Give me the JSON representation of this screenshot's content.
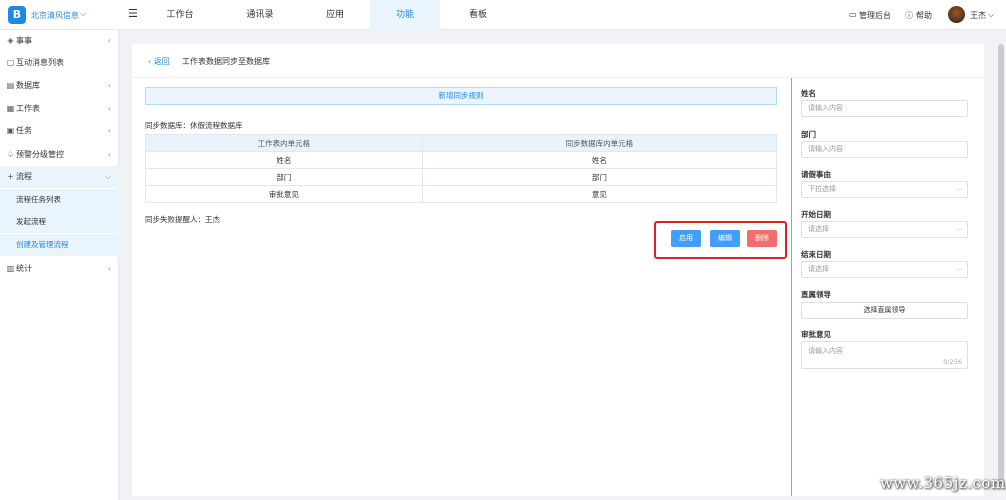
{
  "topbar": {
    "logo_char": "B",
    "org_name": "北京清风信息",
    "menu_toggle": "☰",
    "nav": [
      "工作台",
      "通讯录",
      "应用",
      "功能",
      "看板"
    ],
    "admin": "管理后台",
    "help": "帮助",
    "user": "王杰"
  },
  "sidebar": {
    "items": [
      {
        "label": "事事",
        "icon": "layers-icon"
      },
      {
        "label": "互动消息列表",
        "icon": "message-icon"
      },
      {
        "label": "数据库",
        "icon": "database-icon"
      },
      {
        "label": "工作表",
        "icon": "sheet-icon"
      },
      {
        "label": "任务",
        "icon": "task-icon"
      },
      {
        "label": "预警分级管控",
        "icon": "bell-icon"
      },
      {
        "label": "流程",
        "icon": "plus-icon"
      },
      {
        "label": "统计",
        "icon": "chart-icon"
      }
    ],
    "sub": [
      "流程任务列表",
      "发起流程",
      "创建及管理流程"
    ]
  },
  "main": {
    "back": "返回",
    "title": "工作表数据同步至数据库",
    "add_rule": "新增同步规则",
    "sync_db": "同步数据库：休假流程数据库",
    "table": {
      "headers": [
        "工作表内单元格",
        "同步数据库内单元格"
      ],
      "rows": [
        [
          "姓名",
          "姓名"
        ],
        [
          "部门",
          "部门"
        ],
        [
          "审批意见",
          "意见"
        ]
      ]
    },
    "remind": "同步失败提醒人：王杰",
    "buttons": {
      "enable": "启用",
      "edit": "编辑",
      "delete": "删除"
    }
  },
  "form": {
    "name_label": "姓名",
    "name_placeholder": "请输入内容",
    "dept_label": "部门",
    "dept_placeholder": "请输入内容",
    "reason_label": "请假事由",
    "reason_placeholder": "下拉选择",
    "start_label": "开始日期",
    "start_placeholder": "请选择",
    "end_label": "结束日期",
    "end_placeholder": "请选择",
    "leader_label": "直属领导",
    "leader_button": "选择直属领导",
    "opinion_label": "审批意见",
    "opinion_placeholder": "请输入内容",
    "opinion_count": "0/256"
  },
  "watermark": "www.365jz.com",
  "colors": {
    "accent": "#1e88e5",
    "danger": "#f56c6c",
    "highlight_box": "#e02020"
  }
}
